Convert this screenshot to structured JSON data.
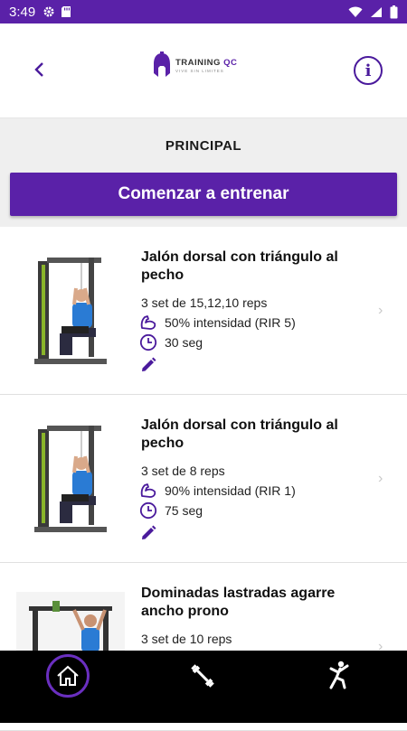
{
  "status_bar": {
    "time": "3:49",
    "icons": [
      "gear-icon",
      "sd-card-icon",
      "wifi-icon",
      "signal-icon",
      "battery-icon"
    ]
  },
  "header": {
    "logo_brand": "TRAINING",
    "logo_brand_accent": "QC",
    "logo_tagline": "VIVE SIN LIMITES",
    "info_label": "i"
  },
  "section": {
    "title": "PRINCIPAL",
    "start_button": "Comenzar a entrenar"
  },
  "exercises": [
    {
      "title": "Jalón dorsal con triángulo al pecho",
      "sets": "3 set de 15,12,10 reps",
      "intensity": "50% intensidad  (RIR 5)",
      "rest": "30 seg"
    },
    {
      "title": "Jalón dorsal con triángulo al pecho",
      "sets": "3 set de 8 reps",
      "intensity": "90% intensidad  (RIR 1)",
      "rest": "75 seg"
    },
    {
      "title": "Dominadas lastradas agarre ancho prono",
      "sets": "3 set de 10 reps",
      "intensity": "",
      "rest": ""
    }
  ],
  "colors": {
    "brand": "#5a21a8",
    "accent_dark": "#4a1a9c",
    "background_section": "#efefef"
  },
  "bottom_nav": {
    "items": [
      "home-icon",
      "dumbbell-icon",
      "stretch-icon"
    ],
    "active": "home-icon"
  }
}
